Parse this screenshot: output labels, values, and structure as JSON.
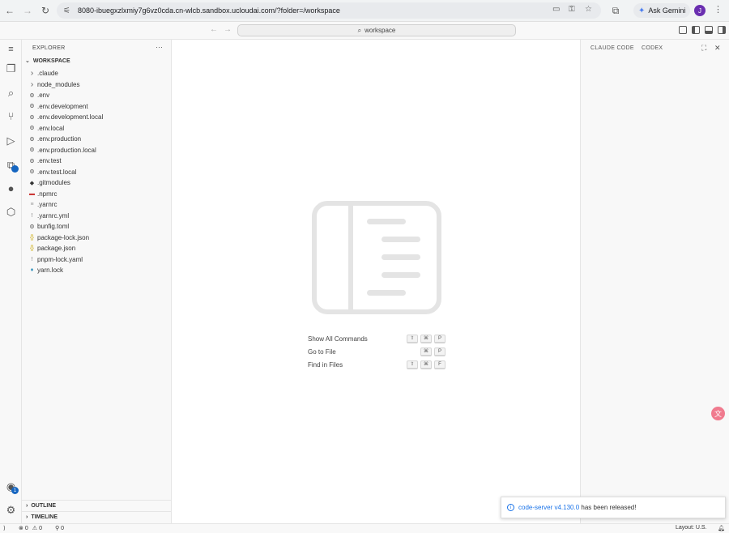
{
  "browser": {
    "url": "8080-ibuegxzlxmiy7g6vz0cda.cn-wlcb.sandbox.ucloudai.com/?folder=/workspace",
    "gemini_label": "Ask Gemini",
    "avatar_letter": "J"
  },
  "titlebar": {
    "search_text": "workspace"
  },
  "activity": {
    "extensions_badge": "",
    "accounts_badge": "1"
  },
  "sidebar": {
    "title": "EXPLORER",
    "more": "···",
    "workspace": "WORKSPACE",
    "items": [
      {
        "label": ".claude",
        "icon": "chevron-right",
        "glyph": "›"
      },
      {
        "label": "node_modules",
        "icon": "chevron-right",
        "glyph": "›"
      },
      {
        "label": ".env",
        "icon": "gear",
        "glyph": "⚙"
      },
      {
        "label": ".env.development",
        "icon": "gear",
        "glyph": "⚙"
      },
      {
        "label": ".env.development.local",
        "icon": "gear",
        "glyph": "⚙"
      },
      {
        "label": ".env.local",
        "icon": "gear",
        "glyph": "⚙"
      },
      {
        "label": ".env.production",
        "icon": "gear",
        "glyph": "⚙"
      },
      {
        "label": ".env.production.local",
        "icon": "gear",
        "glyph": "⚙"
      },
      {
        "label": ".env.test",
        "icon": "gear",
        "glyph": "⚙"
      },
      {
        "label": ".env.test.local",
        "icon": "gear",
        "glyph": "⚙"
      },
      {
        "label": ".gitmodules",
        "icon": "git",
        "glyph": "◆"
      },
      {
        "label": ".npmrc",
        "icon": "npm",
        "glyph": "▬"
      },
      {
        "label": ".yarnrc",
        "icon": "lines",
        "glyph": "≡"
      },
      {
        "label": ".yarnrc.yml",
        "icon": "exclamation",
        "glyph": "!"
      },
      {
        "label": "bunfig.toml",
        "icon": "gear",
        "glyph": "⚙"
      },
      {
        "label": "package-lock.json",
        "icon": "braces",
        "glyph": "{}"
      },
      {
        "label": "package.json",
        "icon": "braces",
        "glyph": "{}"
      },
      {
        "label": "pnpm-lock.yaml",
        "icon": "exclamation",
        "glyph": "!"
      },
      {
        "label": "yarn.lock",
        "icon": "yarn",
        "glyph": "♦"
      }
    ],
    "outline": "OUTLINE",
    "timeline": "TIMELINE"
  },
  "editor": {
    "shortcuts": [
      {
        "label": "Show All Commands",
        "keys": [
          "⇧",
          "⌘",
          "P"
        ]
      },
      {
        "label": "Go to File",
        "keys": [
          "⌘",
          "P"
        ]
      },
      {
        "label": "Find in Files",
        "keys": [
          "⇧",
          "⌘",
          "F"
        ]
      }
    ]
  },
  "aux": {
    "tab1": "CLAUDE CODE",
    "tab2": "CODEX"
  },
  "notification": {
    "link": "code-server v4.130.0",
    "text": "has been released!"
  },
  "status": {
    "errors": "0",
    "warnings": "0",
    "ports": "0",
    "layout": "Layout: U.S."
  },
  "colors": {
    "accent": "#1a73e8",
    "badge": "#1565c0",
    "avatar": "#6a2fb0"
  }
}
